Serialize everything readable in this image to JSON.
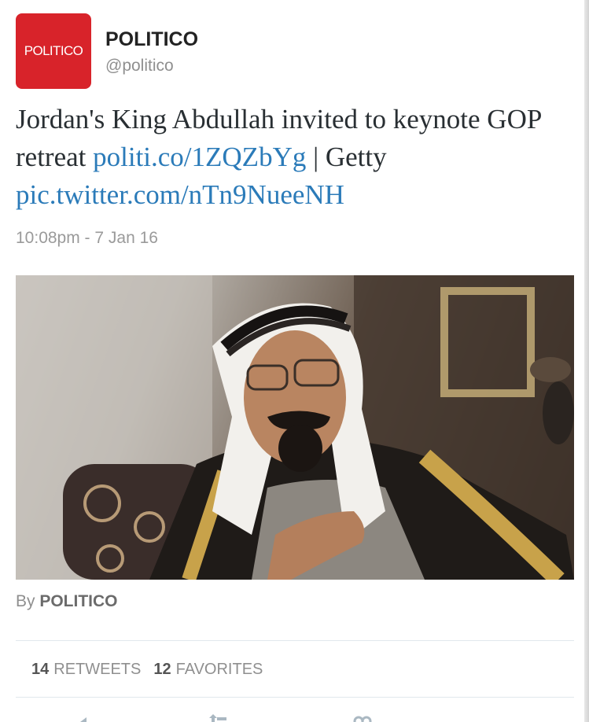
{
  "author": {
    "avatar_text": "POLITICO",
    "display_name": "POLITICO",
    "handle": "@politico"
  },
  "tweet": {
    "text_before": "Jordan's King Abdullah invited to keynote GOP retreat ",
    "link1": "politi.co/1ZQZbYg",
    "text_middle": " | Getty ",
    "link2": "pic.twitter.com/nTn9NueeNH",
    "timestamp": "10:08pm - 7 Jan 16"
  },
  "media": {
    "description": "photo"
  },
  "byline": {
    "prefix": "By ",
    "source": "POLITICO"
  },
  "stats": {
    "retweets_count": "14",
    "retweets_label": "RETWEETS",
    "favorites_count": "12",
    "favorites_label": "FAVORITES"
  },
  "actions": [
    "reply-icon",
    "retweet-icon",
    "favorite-icon"
  ],
  "colors": {
    "brand_red": "#d8232a",
    "link_blue": "#2b7bb9",
    "meta_gray": "#8f8f8f"
  }
}
